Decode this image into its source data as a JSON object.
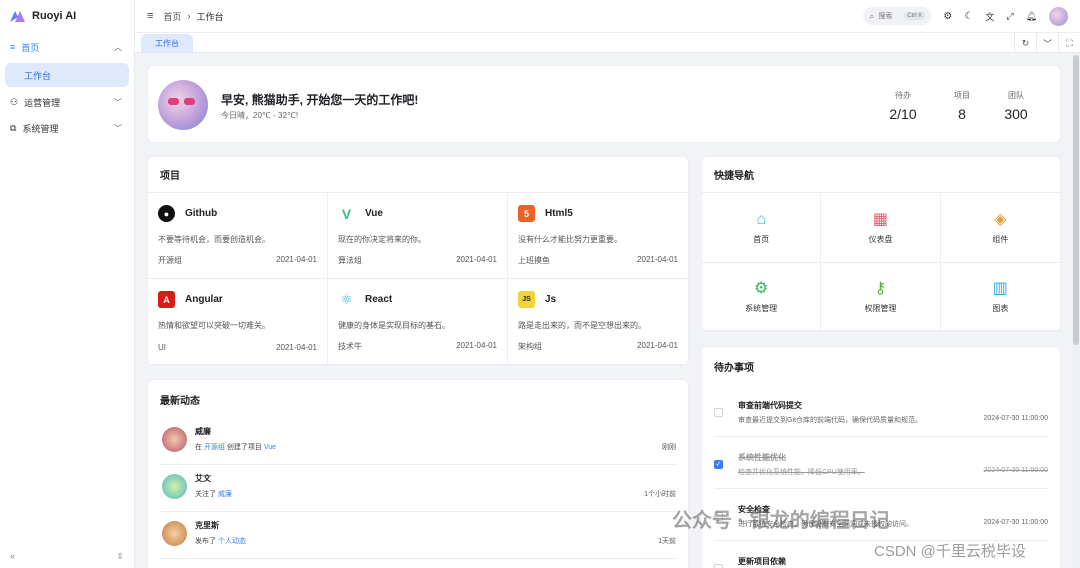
{
  "app": {
    "name": "Ruoyi AI"
  },
  "sidebar": {
    "items": [
      {
        "label": "首页",
        "children": [
          {
            "label": "工作台"
          }
        ]
      },
      {
        "label": "运营管理"
      },
      {
        "label": "系统管理"
      }
    ],
    "collapse": "«",
    "pin": "⇳"
  },
  "topbar": {
    "breadcrumb": [
      "首页",
      "工作台"
    ],
    "search_placeholder": "搜索",
    "search_shortcut": "Ctrl K"
  },
  "tabs": [
    {
      "label": "工作台"
    }
  ],
  "welcome": {
    "title": "早安, 熊猫助手, 开始您一天的工作吧!",
    "subtitle": "今日晴，20℃ - 32℃!",
    "stats": [
      {
        "label": "待办",
        "value": "2/10"
      },
      {
        "label": "项目",
        "value": "8"
      },
      {
        "label": "团队",
        "value": "300"
      }
    ]
  },
  "projects": {
    "title": "项目",
    "items": [
      {
        "name": "Github",
        "desc": "不要等待机会，而要创造机会。",
        "group": "开源组",
        "date": "2021-04-01",
        "color": "#111111",
        "icon": "github-icon"
      },
      {
        "name": "Vue",
        "desc": "现在的你决定将来的你。",
        "group": "算法组",
        "date": "2021-04-01",
        "color": "#3fb883",
        "icon": "vue-icon"
      },
      {
        "name": "Html5",
        "desc": "没有什么才能比努力更重要。",
        "group": "上班摸鱼",
        "date": "2021-04-01",
        "color": "#e96228",
        "icon": "html5-icon"
      },
      {
        "name": "Angular",
        "desc": "热情和欲望可以突破一切难关。",
        "group": "UI",
        "date": "2021-04-01",
        "color": "#dd1b16",
        "icon": "angular-icon"
      },
      {
        "name": "React",
        "desc": "健康的身体是实现目标的基石。",
        "group": "技术牛",
        "date": "2021-04-01",
        "color": "#27b3d6",
        "icon": "react-icon"
      },
      {
        "name": "Js",
        "desc": "路是走出来的，而不是空想出来的。",
        "group": "架构组",
        "date": "2021-04-01",
        "color": "#f2d33a",
        "icon": "js-icon"
      }
    ]
  },
  "quick_nav": {
    "title": "快捷导航",
    "items": [
      {
        "label": "首页",
        "icon": "home-icon",
        "color": "#38c7c0"
      },
      {
        "label": "仪表盘",
        "icon": "dashboard-icon",
        "color": "#e35b6b"
      },
      {
        "label": "组件",
        "icon": "components-icon",
        "color": "#ee9a2e"
      },
      {
        "label": "系统管理",
        "icon": "settings-icon",
        "color": "#3cb46f"
      },
      {
        "label": "权限管理",
        "icon": "key-icon",
        "color": "#59b33b"
      },
      {
        "label": "图表",
        "icon": "bar-chart-icon",
        "color": "#2fa9e8"
      }
    ]
  },
  "news": {
    "title": "最新动态",
    "items": [
      {
        "name": "威廉",
        "prefix": "在",
        "link1": "开源组",
        "mid": "创建了项目",
        "link2": "Vue",
        "time": "刚刚"
      },
      {
        "name": "艾文",
        "prefix": "关注了",
        "link1": "威廉",
        "mid": "",
        "link2": "",
        "time": "1个小时前"
      },
      {
        "name": "克里斯",
        "prefix": "发布了",
        "link1": "个人动态",
        "mid": "",
        "link2": "",
        "time": "1天前"
      }
    ]
  },
  "todo": {
    "title": "待办事项",
    "items": [
      {
        "title": "审查前端代码提交",
        "desc": "审查最近提交到Git仓库的前端代码，确保代码质量和规范。",
        "time": "2024-07-30 11:00:00",
        "done": false
      },
      {
        "title": "系统性能优化",
        "desc": "检查并优化系统性能，降低CPU使用率。",
        "time": "2024-07-30 11:00:00",
        "done": true
      },
      {
        "title": "安全检查",
        "desc": "进行系统安全检查，确保没有安全漏洞或未授权的访问。",
        "time": "2024-07-30 11:00:00",
        "done": false
      },
      {
        "title": "更新项目依赖",
        "desc": "",
        "time": "",
        "done": false
      }
    ]
  },
  "watermark": {
    "line1": "公众号 · 银龙的编程日记",
    "line2": "CSDN @千里云税毕设"
  }
}
